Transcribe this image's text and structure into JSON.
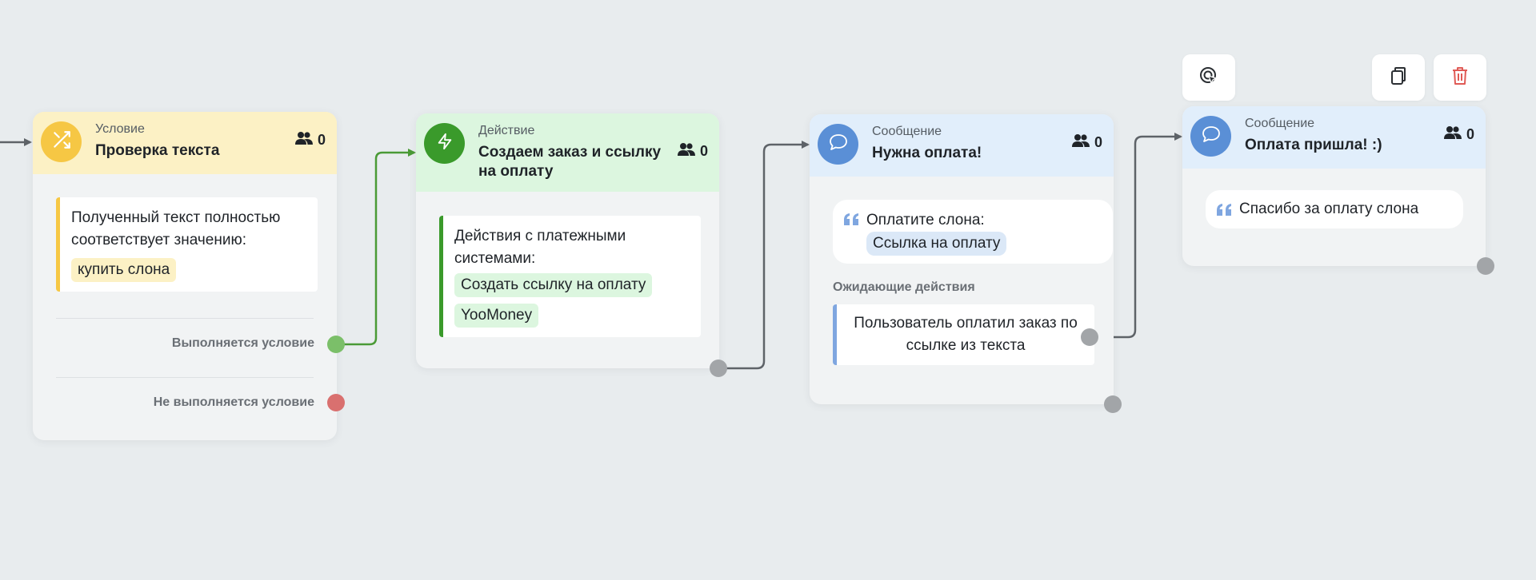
{
  "colors": {
    "condition_accent": "#f6c744",
    "action_accent": "#3a9a2b",
    "message_accent": "#5a8fd6",
    "success_wire": "#4a9a36",
    "wire": "#5e6368"
  },
  "nodes": {
    "condition": {
      "kind": "Условие",
      "title": "Проверка текста",
      "subscribers": "0",
      "icon": "shuffle-icon",
      "body_text": "Полученный текст полностью соответствует значению:",
      "value_tag": "купить слона",
      "outlet_true": "Выполняется условие",
      "outlet_false": "Не выполняется условие"
    },
    "action": {
      "kind": "Действие",
      "title": "Создаем заказ и ссылку на оплату",
      "subscribers": "0",
      "icon": "bolt-icon",
      "body_text": "Действия с платежными системами:",
      "tags": [
        "Создать ссылку на оплату",
        "YooMoney"
      ]
    },
    "message1": {
      "kind": "Сообщение",
      "title": "Нужна оплата!",
      "subscribers": "0",
      "icon": "chat-bubble-icon",
      "quote_text": "Оплатите слона:",
      "link_tag": "Ссылка на оплату",
      "pending_label": "Ожидающие действия",
      "pending_action": "Пользователь оплатил заказ по ссылке из текста"
    },
    "message2": {
      "kind": "Сообщение",
      "title": "Оплата пришла! :)",
      "subscribers": "0",
      "icon": "chat-bubble-icon",
      "quote_text": "Спасибо за оплату слона"
    }
  },
  "toolbar": {
    "target_icon": "cursor-target-icon",
    "copy_icon": "copy-icon",
    "delete_icon": "trash-icon"
  }
}
